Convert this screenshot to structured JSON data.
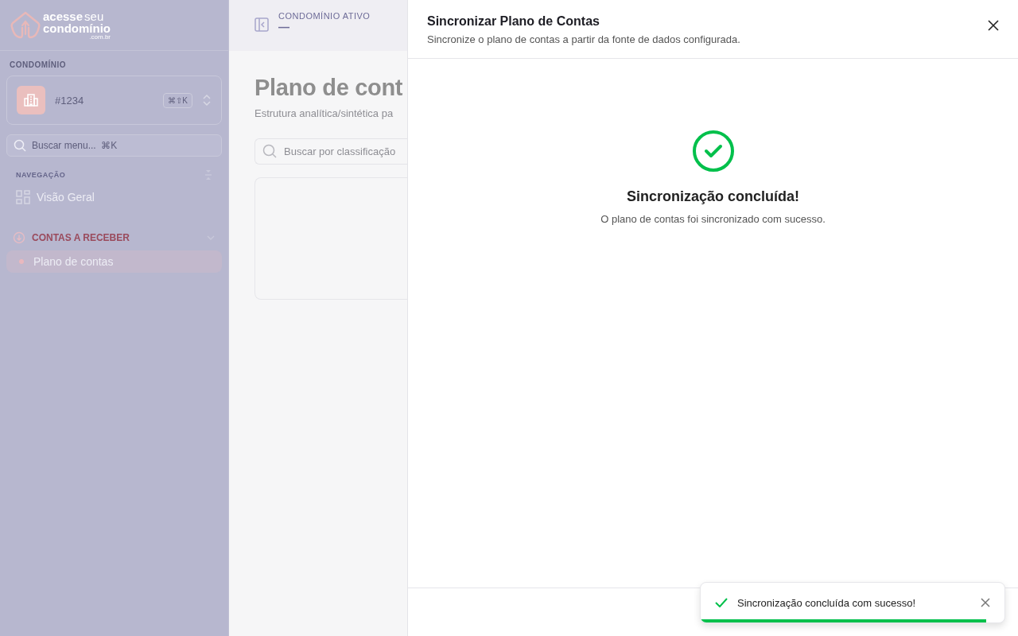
{
  "sidebar": {
    "logo": {
      "line_1_bold": "acesse",
      "line_1_light": "seu",
      "line_2": "condomínio",
      "domain": ".com.br"
    },
    "condo_label": "CONDOMÍNIO",
    "condo": {
      "name": "#1234",
      "shortcut": "⌘⇧K"
    },
    "search": {
      "placeholder": "Buscar menu...  ⌘K"
    },
    "nav_label": "NAVEGAÇÃO",
    "items": [
      {
        "kind": "link",
        "label": "Visão Geral",
        "selected": false
      },
      {
        "kind": "section",
        "label": "CONTAS A RECEBER",
        "expanded": true,
        "children": [
          {
            "label": "Plano de contas",
            "selected": true
          }
        ]
      }
    ]
  },
  "header": {
    "label": "CONDOMÍNIO ATIVO",
    "value": "—"
  },
  "page": {
    "title": "Plano de cont",
    "subtitle": "Estrutura analítica/sintética pa",
    "search": {
      "placeholder": "Buscar por classificação"
    }
  },
  "drawer": {
    "title": "Sincronizar Plano de Contas",
    "subtitle": "Sincronize o plano de contas a partir da fonte de dados configurada.",
    "status": {
      "kind": "success",
      "title": "Sincronização concluída!",
      "message": "O plano de contas foi sincronizado com sucesso."
    }
  },
  "toast": {
    "kind": "success",
    "message": "Sincronização concluída com sucesso!",
    "level": 0.94
  }
}
